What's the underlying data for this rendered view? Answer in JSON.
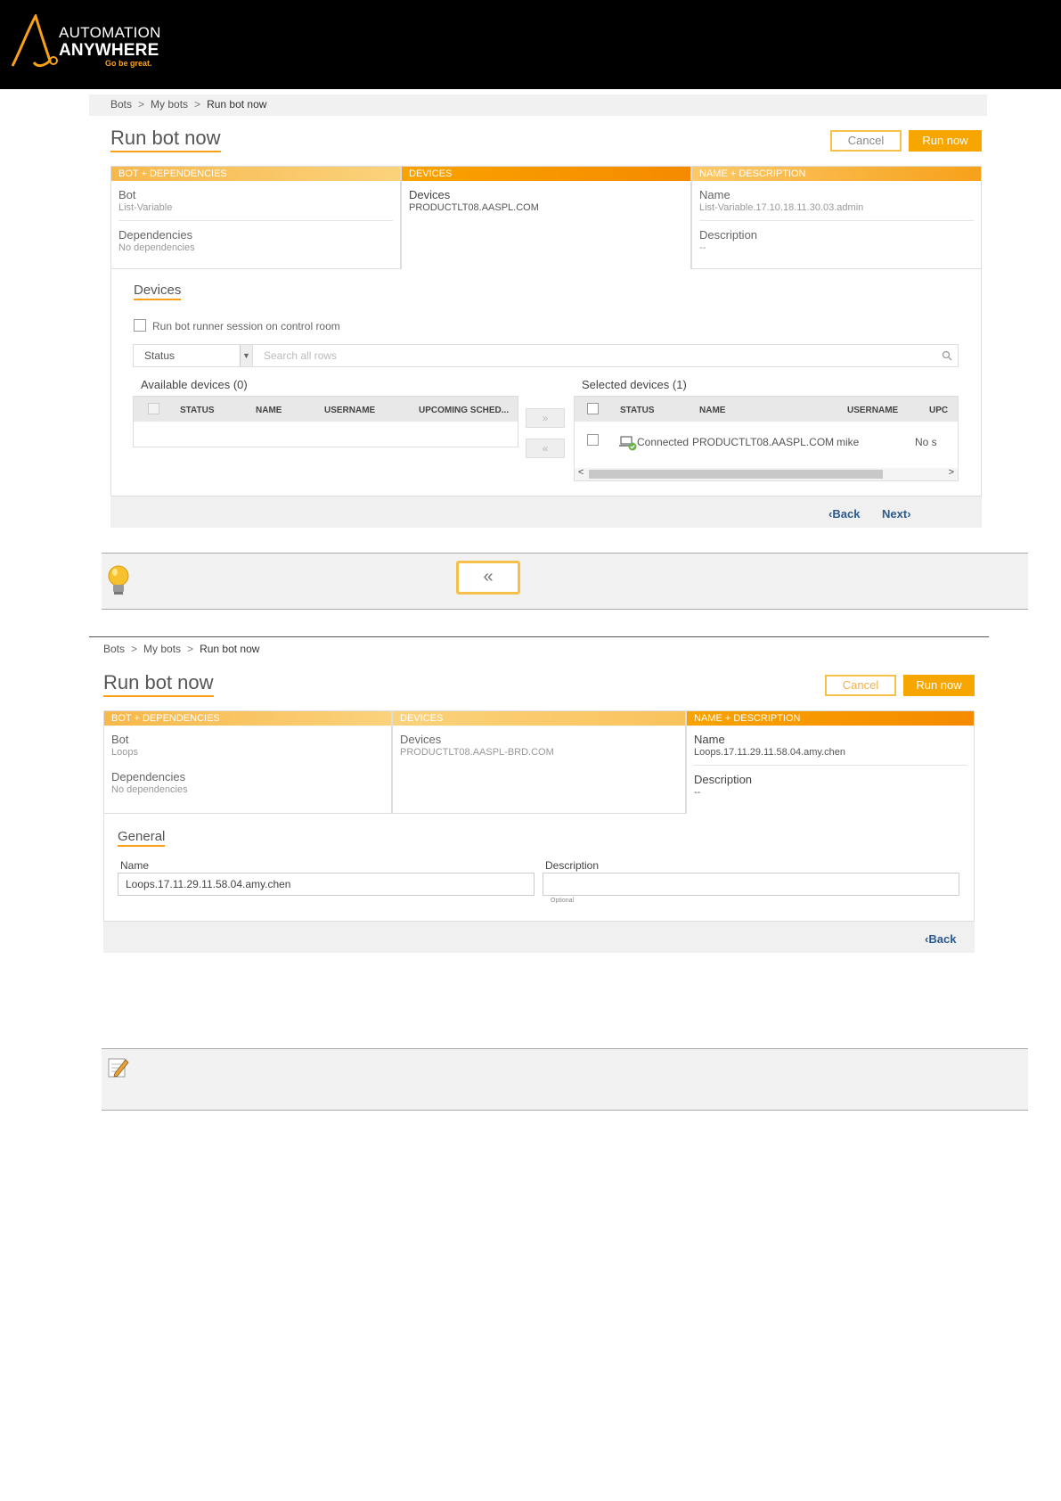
{
  "brand": {
    "line1": "AUTOMATION",
    "line2": "ANYWHERE",
    "tagline": "Go be great."
  },
  "shot1": {
    "breadcrumb": [
      "Bots",
      "My bots",
      "Run bot now"
    ],
    "title": "Run bot now",
    "cancel_label": "Cancel",
    "run_label": "Run now",
    "steps": [
      {
        "header": "BOT + DEPENDENCIES",
        "rows": [
          {
            "label": "Bot",
            "value": "List-Variable"
          },
          {
            "label": "Dependencies",
            "value": "No dependencies"
          }
        ]
      },
      {
        "header": "DEVICES",
        "rows": [
          {
            "label": "Devices",
            "value": "PRODUCTLT08.AASPL.COM"
          }
        ]
      },
      {
        "header": "NAME + DESCRIPTION",
        "rows": [
          {
            "label": "Name",
            "value": "List-Variable.17.10.18.11.30.03.admin"
          },
          {
            "label": "Description",
            "value": "--"
          }
        ]
      }
    ],
    "section_title": "Devices",
    "run_session_label": "Run bot runner session on control room",
    "status_filter": "Status",
    "search_placeholder": "Search all rows",
    "available_title": "Available devices (0)",
    "available_columns": [
      "STATUS",
      "NAME",
      "USERNAME",
      "UPCOMING SCHED..."
    ],
    "selected_title": "Selected devices (1)",
    "selected_columns": [
      "STATUS",
      "NAME",
      "USERNAME",
      "UPC"
    ],
    "selected_row": {
      "status": "Connected",
      "name": "PRODUCTLT08.AASPL.COM",
      "username": "mike",
      "upcoming": "No s"
    },
    "move_right": "»",
    "move_left": "«",
    "back_label": "Back",
    "next_label": "Next"
  },
  "tip": {
    "button_glyph": "«"
  },
  "shot2": {
    "breadcrumb": [
      "Bots",
      "My bots",
      "Run bot now"
    ],
    "title": "Run bot now",
    "cancel_label": "Cancel",
    "run_label": "Run now",
    "steps": [
      {
        "header": "BOT + DEPENDENCIES",
        "rows": [
          {
            "label": "Bot",
            "value": "Loops"
          },
          {
            "label": "Dependencies",
            "value": "No dependencies"
          }
        ]
      },
      {
        "header": "DEVICES",
        "rows": [
          {
            "label": "Devices",
            "value": "PRODUCTLT08.AASPL-BRD.COM"
          }
        ]
      },
      {
        "header": "NAME + DESCRIPTION",
        "rows": [
          {
            "label": "Name",
            "value": "Loops.17.11.29.11.58.04.amy.chen"
          },
          {
            "label": "Description",
            "value": "--"
          }
        ]
      }
    ],
    "section_title": "General",
    "name_label": "Name",
    "name_value": "Loops.17.11.29.11.58.04.amy.chen",
    "description_label": "Description",
    "description_value": "",
    "optional_label": "Optional",
    "back_label": "Back"
  },
  "colors": {
    "accent": "#f7a11a",
    "link": "#2b5a8c",
    "header_bg": "#000000"
  }
}
